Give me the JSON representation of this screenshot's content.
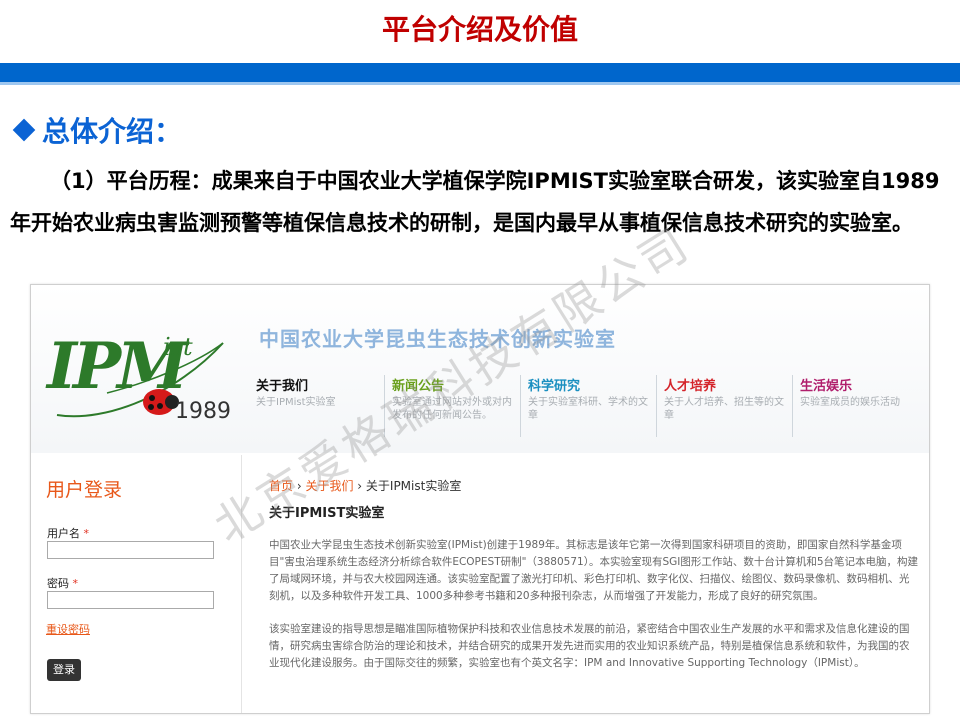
{
  "slide": {
    "title": "平台介绍及价值",
    "section_heading": "总体介绍：",
    "intro_lead": "（1）平台历程：",
    "intro_body": "成果来自于中国农业大学植保学院IPMIST实验室联合研发，该实验室自1989年开始农业病虫害监测预警等植保信息技术的研制，是国内最早从事植保信息技术研究的实验室。",
    "watermark": "北京爱格瑞科技有限公司"
  },
  "colors": {
    "title_red": "#c00000",
    "bar_blue": "#0066cc",
    "heading_blue": "#0b63d4",
    "link_orange": "#e8581a"
  },
  "website": {
    "logo": {
      "text_main": "IPM",
      "text_sub": "ist",
      "year": "1989",
      "icon": "ladybug-icon"
    },
    "site_title": "中国农业大学昆虫生态技术创新实验室",
    "nav": [
      {
        "title": "关于我们",
        "desc": "关于IPMist实验室",
        "color": "#111111"
      },
      {
        "title": "新闻公告",
        "desc": "实验室通过网站对外或对内发布的任何新闻公告。",
        "color": "#6aa01d"
      },
      {
        "title": "科学研究",
        "desc": "关于实验室科研、学术的文章",
        "color": "#1a8fc0"
      },
      {
        "title": "人才培养",
        "desc": "关于人才培养、招生等的文章",
        "color": "#d4242a"
      },
      {
        "title": "生活娱乐",
        "desc": "实验室成员的娱乐活动",
        "color": "#b01e6c"
      }
    ],
    "login": {
      "title": "用户登录",
      "username_label": "用户名",
      "password_label": "密码",
      "required_mark": "*",
      "reset_link": "重设密码",
      "submit_label": "登录"
    },
    "breadcrumb": {
      "home": "首页",
      "sep1": " › ",
      "about": "关于我们",
      "sep2": " › ",
      "current": "关于IPMist实验室"
    },
    "page_heading": "关于IPMIST实验室",
    "paragraph1": "中国农业大学昆虫生态技术创新实验室(IPMist)创建于1989年。其标志是该年它第一次得到国家科研项目的资助，即国家自然科学基金项目\"害虫治理系统生态经济分析综合软件ECOPEST研制\"（3880571）。本实验室现有SGI图形工作站、数十台计算机和5台笔记本电脑，构建了局域网环境，并与农大校园网连通。该实验室配置了激光打印机、彩色打印机、数字化仪、扫描仪、绘图仪、数码录像机、数码相机、光刻机，以及多种软件开发工具、1000多种参考书籍和20多种报刊杂志，从而增强了开发能力，形成了良好的研究氛围。",
    "paragraph2": "该实验室建设的指导思想是瞄准国际植物保护科技和农业信息技术发展的前沿，紧密结合中国农业生产发展的水平和需求及信息化建设的国情，研究病虫害综合防治的理论和技术，并结合研究的成果开发先进而实用的农业知识系统产品，特别是植保信息系统和软件，为我国的农业现代化建设服务。由于国际交往的频繁，实验室也有个英文名字：IPM and Innovative Supporting Technology（IPMist）。"
  }
}
